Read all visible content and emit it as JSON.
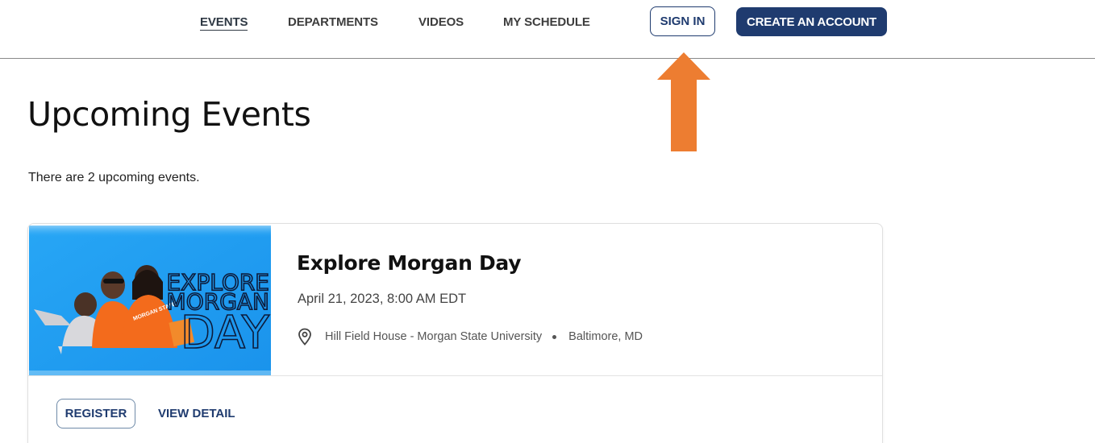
{
  "nav": {
    "events": "EVENTS",
    "departments": "DEPARTMENTS",
    "videos": "VIDEOS",
    "my_schedule": "MY SCHEDULE",
    "sign_in": "SIGN IN",
    "create_account": "CREATE AN ACCOUNT"
  },
  "page": {
    "title": "Upcoming Events",
    "count_text": "There are 2 upcoming events."
  },
  "events": [
    {
      "title": "Explore Morgan Day",
      "date": "April 21, 2023, 8:00 AM EDT",
      "venue": "Hill Field House - Morgan State University",
      "city": "Baltimore, MD",
      "image_lines": [
        "EXPLORE",
        "MORGAN",
        "DAY"
      ],
      "register_label": "REGISTER",
      "detail_label": "VIEW DETAIL"
    }
  ],
  "colors": {
    "brand_navy": "#1f3b6f",
    "annotation_orange": "#ed7d31",
    "banner_blue": "#1e9ff0"
  },
  "icons": {
    "location": "map-pin-icon",
    "annotation": "up-arrow-icon"
  }
}
